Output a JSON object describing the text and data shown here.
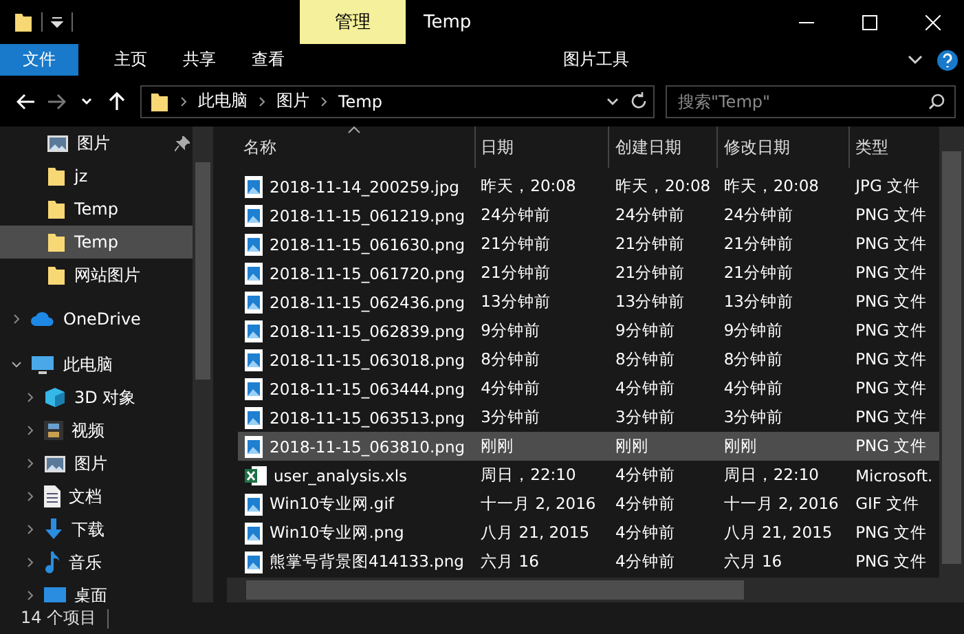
{
  "window": {
    "title": "Temp",
    "context_tab": "管理"
  },
  "ribbon": {
    "tabs": [
      {
        "label": "文件",
        "kind": "file"
      },
      {
        "label": "主页",
        "kind": "tab"
      },
      {
        "label": "共享",
        "kind": "tab"
      },
      {
        "label": "查看",
        "kind": "tab"
      },
      {
        "label": "图片工具",
        "kind": "context"
      }
    ]
  },
  "address_bar": {
    "path": [
      "此电脑",
      "图片",
      "Temp"
    ]
  },
  "search": {
    "placeholder": "搜索\"Temp\""
  },
  "sidebar": {
    "quick_access": [
      {
        "label": "图片",
        "kind": "pictures",
        "pinned": true,
        "selected": false
      },
      {
        "label": "jz",
        "kind": "folder",
        "pinned": false,
        "selected": false
      },
      {
        "label": "Temp",
        "kind": "folder",
        "pinned": false,
        "selected": false
      },
      {
        "label": "Temp",
        "kind": "folder",
        "pinned": false,
        "selected": true
      },
      {
        "label": "网站图片",
        "kind": "folder",
        "pinned": false,
        "selected": false
      }
    ],
    "items": [
      {
        "label": "OneDrive",
        "kind": "cloud",
        "expanded": false
      },
      {
        "label": "此电脑",
        "kind": "pc",
        "expanded": true,
        "children": [
          {
            "label": "3D 对象",
            "kind": "cube",
            "expanded": false
          },
          {
            "label": "视频",
            "kind": "video",
            "expanded": false
          },
          {
            "label": "图片",
            "kind": "pictures",
            "expanded": false
          },
          {
            "label": "文档",
            "kind": "document",
            "expanded": false
          },
          {
            "label": "下载",
            "kind": "download",
            "expanded": false
          },
          {
            "label": "音乐",
            "kind": "music",
            "expanded": false
          },
          {
            "label": "桌面",
            "kind": "desktop",
            "expanded": false
          }
        ]
      }
    ]
  },
  "table": {
    "columns": [
      {
        "label": "名称",
        "sorted": true
      },
      {
        "label": "日期",
        "sorted": false
      },
      {
        "label": "创建日期",
        "sorted": false
      },
      {
        "label": "修改日期",
        "sorted": false
      },
      {
        "label": "类型",
        "sorted": false
      }
    ],
    "rows": [
      {
        "kind": "image",
        "selected": false,
        "cells": [
          "2018-11-14_200259.jpg",
          "昨天，20:08",
          "昨天，20:08",
          "昨天，20:08",
          "JPG 文件"
        ]
      },
      {
        "kind": "image",
        "selected": false,
        "cells": [
          "2018-11-15_061219.png",
          "24分钟前",
          "24分钟前",
          "24分钟前",
          "PNG 文件"
        ]
      },
      {
        "kind": "image",
        "selected": false,
        "cells": [
          "2018-11-15_061630.png",
          "21分钟前",
          "21分钟前",
          "21分钟前",
          "PNG 文件"
        ]
      },
      {
        "kind": "image",
        "selected": false,
        "cells": [
          "2018-11-15_061720.png",
          "21分钟前",
          "21分钟前",
          "21分钟前",
          "PNG 文件"
        ]
      },
      {
        "kind": "image",
        "selected": false,
        "cells": [
          "2018-11-15_062436.png",
          "13分钟前",
          "13分钟前",
          "13分钟前",
          "PNG 文件"
        ]
      },
      {
        "kind": "image",
        "selected": false,
        "cells": [
          "2018-11-15_062839.png",
          "9分钟前",
          "9分钟前",
          "9分钟前",
          "PNG 文件"
        ]
      },
      {
        "kind": "image",
        "selected": false,
        "cells": [
          "2018-11-15_063018.png",
          "8分钟前",
          "8分钟前",
          "8分钟前",
          "PNG 文件"
        ]
      },
      {
        "kind": "image",
        "selected": false,
        "cells": [
          "2018-11-15_063444.png",
          "4分钟前",
          "4分钟前",
          "4分钟前",
          "PNG 文件"
        ]
      },
      {
        "kind": "image",
        "selected": false,
        "cells": [
          "2018-11-15_063513.png",
          "3分钟前",
          "3分钟前",
          "3分钟前",
          "PNG 文件"
        ]
      },
      {
        "kind": "image",
        "selected": true,
        "cells": [
          "2018-11-15_063810.png",
          "刚刚",
          "刚刚",
          "刚刚",
          "PNG 文件"
        ]
      },
      {
        "kind": "excel",
        "selected": false,
        "cells": [
          "user_analysis.xls",
          "周日，22:10",
          "4分钟前",
          "周日，22:10",
          "Microsoft."
        ]
      },
      {
        "kind": "image",
        "selected": false,
        "cells": [
          "Win10专业网.gif",
          "十一月 2, 2016",
          "4分钟前",
          "十一月 2, 2016",
          "GIF 文件"
        ]
      },
      {
        "kind": "image",
        "selected": false,
        "cells": [
          "Win10专业网.png",
          "八月 21, 2015",
          "4分钟前",
          "八月 21, 2015",
          "PNG 文件"
        ]
      },
      {
        "kind": "image",
        "selected": false,
        "cells": [
          "熊掌号背景图414133.png",
          "六月 16",
          "4分钟前",
          "六月 16",
          "PNG 文件"
        ]
      }
    ]
  },
  "status_bar": {
    "count": "14 个项目"
  }
}
